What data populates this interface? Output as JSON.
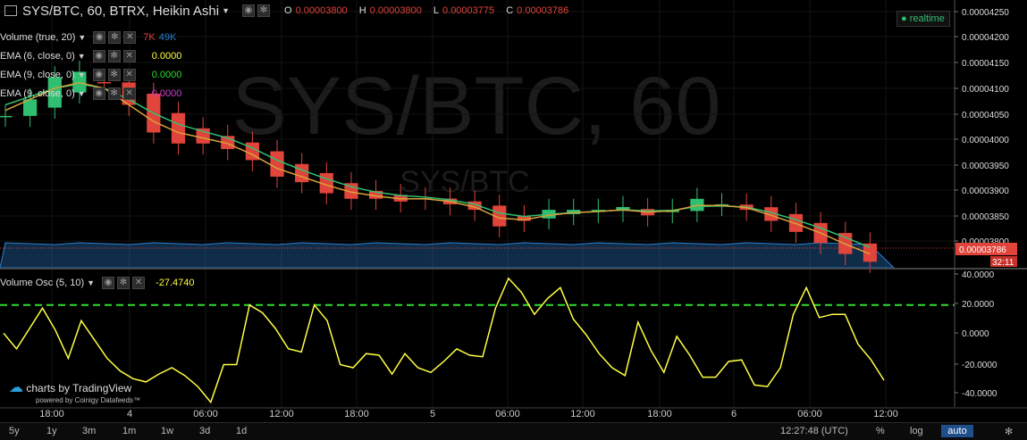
{
  "header": {
    "symbol_title": "SYS/BTC, 60, BTRX, Heikin Ashi",
    "ohlc": [
      {
        "key": "O",
        "value": "0.00003800"
      },
      {
        "key": "H",
        "value": "0.00003800"
      },
      {
        "key": "L",
        "value": "0.00003775"
      },
      {
        "key": "C",
        "value": "0.00003786"
      }
    ],
    "realtime_label": "realtime"
  },
  "watermark": {
    "main": "SYS/BTC, 60",
    "sub": "SYS/BTC"
  },
  "legends": {
    "volume": {
      "label": "Volume (true, 20)",
      "v1": "7K",
      "v2": "49K"
    },
    "ema1": {
      "label": "EMA (6, close, 0)",
      "value": "0.0000"
    },
    "ema2": {
      "label": "EMA (9, close, 0)",
      "value": "0.0000"
    },
    "ema3": {
      "label": "EMA (9, close, 0)",
      "value": "0.0000"
    },
    "osc": {
      "label": "Volume Osc (5, 10)",
      "value": "-27.4740"
    }
  },
  "price_axis": {
    "ticks": [
      "0.00004250",
      "0.00004200",
      "0.00004150",
      "0.00004100",
      "0.00004050",
      "0.00004000",
      "0.00003950",
      "0.00003900",
      "0.00003850",
      "0.00003800"
    ],
    "current_price": "0.00003786",
    "countdown": "32:11"
  },
  "osc_axis": {
    "ticks": [
      "40.0000",
      "20.0000",
      "0.0000",
      "-20.0000",
      "-40.0000"
    ]
  },
  "time_axis": [
    "18:00",
    "4",
    "06:00",
    "12:00",
    "18:00",
    "5",
    "06:00",
    "12:00",
    "18:00",
    "6",
    "06:00",
    "12:00"
  ],
  "branding": {
    "main": "charts by TradingView",
    "sub": "powered by Coinigy Datafeeds™"
  },
  "bottom_bar": {
    "timeframes": [
      "5y",
      "1y",
      "3m",
      "1m",
      "1w",
      "3d",
      "1d"
    ],
    "clock": "12:27:48 (UTC)",
    "percent": "%",
    "log": "log",
    "auto": "auto"
  },
  "colors": {
    "up": "#2fbf71",
    "down": "#e0443a",
    "osc_line": "#ffff44",
    "osc_level": "#2fdc2f",
    "ema_green": "#2fbf71",
    "ema_orange": "#d6a23a",
    "volume_ma": "#2c7fd1"
  },
  "chart_data": [
    {
      "type": "candlestick",
      "title": "SYS/BTC, 60, BTRX, Heikin Ashi",
      "ylim": [
        3.78e-05,
        4.255e-05
      ],
      "x": [
        "18:00",
        "4",
        "06:00",
        "12:00",
        "18:00",
        "5",
        "06:00",
        "12:00",
        "18:00",
        "6",
        "06:00",
        "12:00"
      ],
      "close": [
        4.05e-05,
        4.08e-05,
        4.12e-05,
        4.13e-05,
        4.11e-05,
        4.07e-05,
        4.02e-05,
        4e-05,
        4e-05,
        3.99e-05,
        3.97e-05,
        3.94e-05,
        3.93e-05,
        3.91e-05,
        3.9e-05,
        3.9e-05,
        3.895e-05,
        3.9e-05,
        3.89e-05,
        3.88e-05,
        3.85e-05,
        3.86e-05,
        3.88e-05,
        3.88e-05,
        3.88e-05,
        3.885e-05,
        3.87e-05,
        3.88e-05,
        3.9e-05,
        3.89e-05,
        3.88e-05,
        3.86e-05,
        3.84e-05,
        3.82e-05,
        3.8e-05,
        3.786e-05
      ],
      "ema_fast": [
        4.06e-05,
        4.08e-05,
        4.1e-05,
        4.11e-05,
        4.1e-05,
        4.07e-05,
        4.04e-05,
        4.02e-05,
        4.01e-05,
        4e-05,
        3.98e-05,
        3.955e-05,
        3.94e-05,
        3.925e-05,
        3.912e-05,
        3.905e-05,
        3.9e-05,
        3.9e-05,
        3.895e-05,
        3.885e-05,
        3.865e-05,
        3.862e-05,
        3.87e-05,
        3.875e-05,
        3.877e-05,
        3.88e-05,
        3.876e-05,
        3.878e-05,
        3.888e-05,
        3.888e-05,
        3.884e-05,
        3.87e-05,
        3.855e-05,
        3.838e-05,
        3.818e-05,
        3.8e-05
      ],
      "ema_slow": [
        4.07e-05,
        4.085e-05,
        4.1e-05,
        4.108e-05,
        4.1e-05,
        4.08e-05,
        4.055e-05,
        4.035e-05,
        4.022e-05,
        4.01e-05,
        3.992e-05,
        3.97e-05,
        3.952e-05,
        3.936e-05,
        3.922e-05,
        3.912e-05,
        3.906e-05,
        3.903e-05,
        3.898e-05,
        3.89e-05,
        3.874e-05,
        3.868e-05,
        3.872e-05,
        3.875e-05,
        3.877e-05,
        3.88e-05,
        3.878e-05,
        3.879e-05,
        3.886e-05,
        3.887e-05,
        3.885e-05,
        3.875e-05,
        3.862e-05,
        3.847e-05,
        3.83e-05,
        3.812e-05
      ]
    },
    {
      "type": "line",
      "title": "Volume Osc (5, 10)",
      "ylim": [
        -45,
        42
      ],
      "levels": [
        20
      ],
      "values": [
        2,
        -8,
        5,
        18,
        4,
        -14,
        10,
        -2,
        -14,
        -22,
        -27,
        -29,
        -24,
        -20,
        -25,
        -32,
        -42,
        -18,
        -18,
        20,
        15,
        5,
        -8,
        -10,
        20,
        10,
        -18,
        -20,
        -11,
        -12,
        -24,
        -11,
        -20,
        -23,
        -16,
        -8,
        -12,
        -13,
        18,
        37,
        28,
        14,
        24,
        31,
        11,
        1,
        -11,
        -20,
        -25,
        9,
        -9,
        -23,
        0,
        -12,
        -26,
        -26,
        -16,
        -15,
        -31,
        -32,
        -20,
        14,
        31,
        12,
        14,
        14,
        -5,
        -15,
        -28
      ]
    }
  ]
}
